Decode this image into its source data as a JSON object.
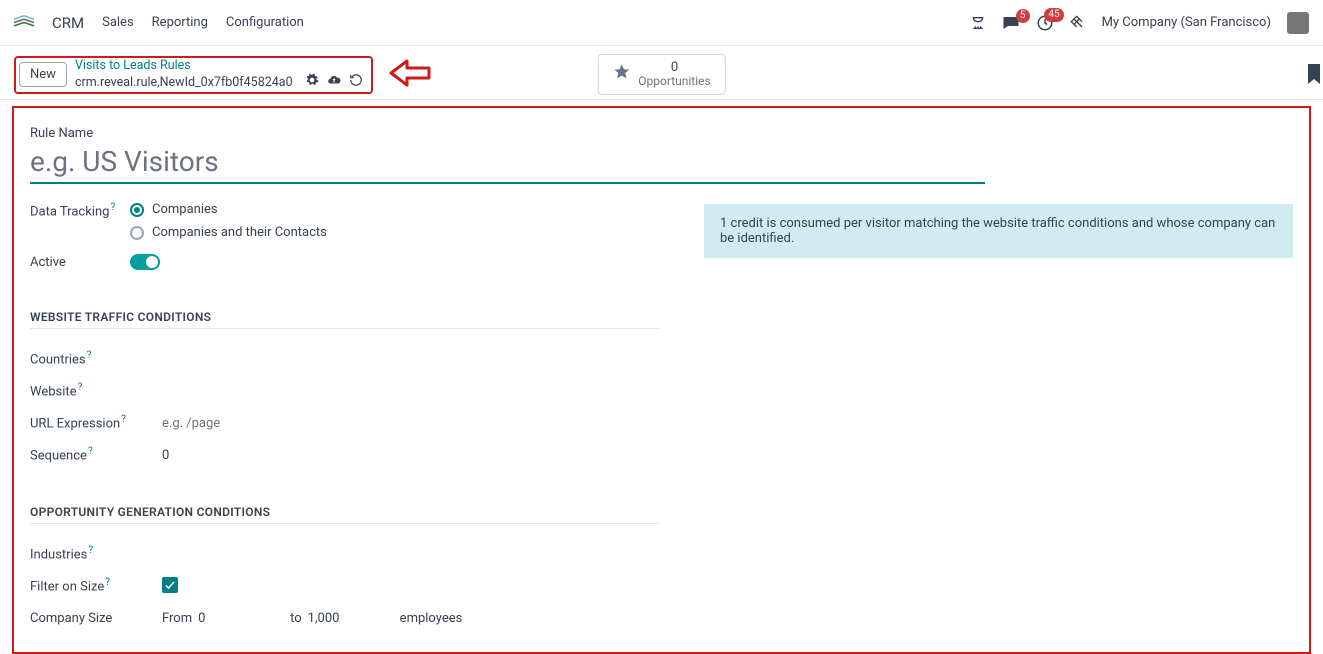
{
  "topbar": {
    "app": "CRM",
    "menu": [
      "Sales",
      "Reporting",
      "Configuration"
    ],
    "msg_badge": "5",
    "activity_badge": "45",
    "company": "My Company (San Francisco)"
  },
  "breadcrumb": {
    "new_label": "New",
    "link": "Visits to Leads Rules",
    "sub": "crm.reveal.rule,NewId_0x7fb0f45824a0"
  },
  "opportunities": {
    "count": "0",
    "label": "Opportunities"
  },
  "form": {
    "rule_name_label": "Rule Name",
    "rule_name_placeholder": "e.g. US Visitors",
    "data_tracking_label": "Data Tracking",
    "radio_companies": "Companies",
    "radio_companies_contacts": "Companies and their Contacts",
    "active_label": "Active",
    "info_text": "1 credit is consumed per visitor matching the website traffic conditions and whose company can be identified.",
    "section_traffic": "WEBSITE TRAFFIC CONDITIONS",
    "countries_label": "Countries",
    "website_label": "Website",
    "url_expr_label": "URL Expression",
    "url_expr_placeholder": "e.g. /page",
    "sequence_label": "Sequence",
    "sequence_value": "0",
    "section_opp": "OPPORTUNITY GENERATION CONDITIONS",
    "industries_label": "Industries",
    "filter_size_label": "Filter on Size",
    "company_size_label": "Company Size",
    "from_label": "From",
    "from_value": "0",
    "to_label": "to",
    "to_value": "1,000",
    "employees_label": "employees"
  }
}
